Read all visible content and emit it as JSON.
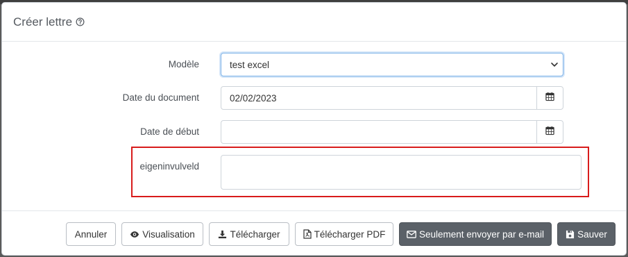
{
  "modal": {
    "title": "Créer lettre"
  },
  "form": {
    "model": {
      "label": "Modèle",
      "value": "test excel"
    },
    "document_date": {
      "label": "Date du document",
      "value": "02/02/2023"
    },
    "start_date": {
      "label": "Date de début",
      "value": ""
    },
    "custom_field": {
      "label": "eigeninvulveld",
      "value": ""
    }
  },
  "footer": {
    "cancel": "Annuler",
    "preview": "Visualisation",
    "download": "Télécharger",
    "download_pdf": "Télécharger PDF",
    "email_only": "Seulement envoyer par e-mail",
    "save": "Sauver"
  },
  "colors": {
    "highlight": "#d81b1b",
    "dark_button": "#5b6168",
    "focus_border": "#7fb3e8"
  },
  "icons": {
    "title_help": "question-circle-icon",
    "select": "chevron-down-icon",
    "date_picker": "calendar-icon",
    "preview": "eye-icon",
    "download": "download-icon",
    "pdf": "file-pdf-icon",
    "email": "envelope-icon",
    "save": "floppy-disk-icon"
  }
}
